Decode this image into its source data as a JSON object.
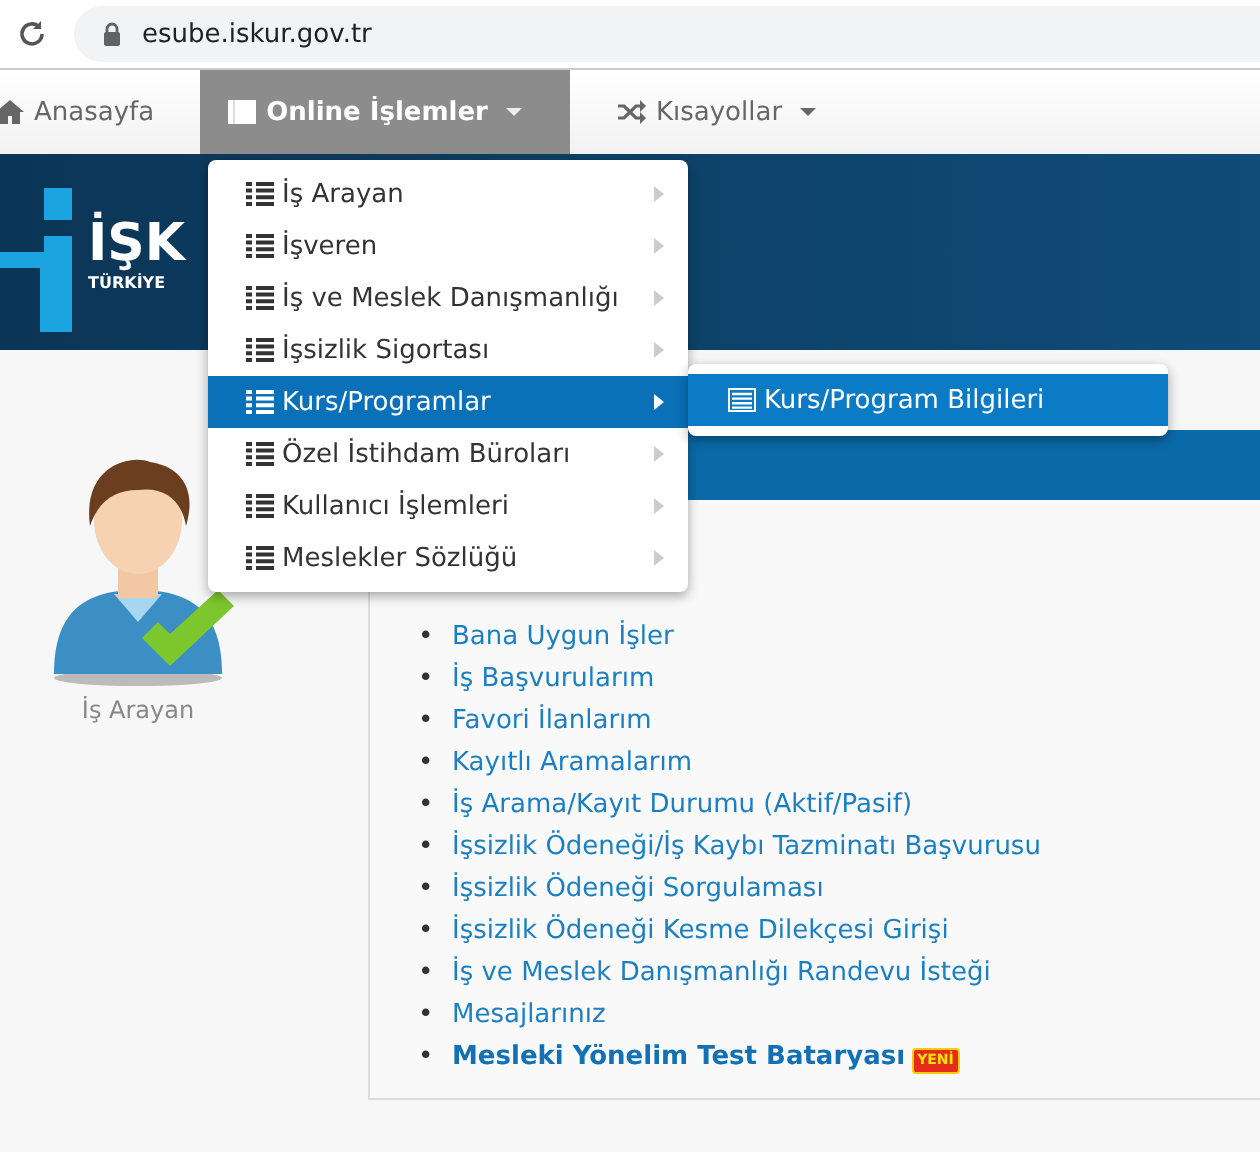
{
  "browser": {
    "address": "esube.iskur.gov.tr"
  },
  "nav": [
    {
      "label": "Anasayfa",
      "kind": "home",
      "selected": false
    },
    {
      "label": "Online İşlemler",
      "kind": "services",
      "selected": true
    },
    {
      "label": "Kısayollar",
      "kind": "shortcuts",
      "selected": false
    }
  ],
  "banner": {
    "logo": "İŞK",
    "subtitle": "TÜRKİYE"
  },
  "menu": [
    {
      "label": "İş Arayan",
      "selected": false
    },
    {
      "label": "İşveren",
      "selected": false
    },
    {
      "label": "İş ve Meslek Danışmanlığı",
      "selected": false
    },
    {
      "label": "İşsizlik Sigortası",
      "selected": false
    },
    {
      "label": "Kurs/Programlar",
      "selected": true
    },
    {
      "label": "Özel İstihdam Büroları",
      "selected": false
    },
    {
      "label": "Kullanıcı İşlemleri",
      "selected": false
    },
    {
      "label": "Meslekler Sözlüğü",
      "selected": false
    }
  ],
  "submenu": [
    {
      "label": "Kurs/Program Bilgileri",
      "selected": true
    }
  ],
  "profile": {
    "label": "İş Arayan"
  },
  "links": [
    {
      "bullet": "•",
      "label": "Bana Uygun İşler",
      "kind": "plain"
    },
    {
      "bullet": "•",
      "label": "İş Başvurularım",
      "kind": "plain"
    },
    {
      "bullet": "•",
      "label": "Favori İlanlarım",
      "kind": "plain"
    },
    {
      "bullet": "•",
      "label": "Kayıtlı Aramalarım",
      "kind": "plain"
    },
    {
      "bullet": "•",
      "label": "İş Arama/Kayıt Durumu (Aktif/Pasif)",
      "kind": "plain"
    },
    {
      "bullet": "•",
      "label": "İşsizlik Ödeneği/İş Kaybı Tazminatı Başvurusu",
      "kind": "plain"
    },
    {
      "bullet": "•",
      "label": "İşsizlik Ödeneği Sorgulaması",
      "kind": "plain"
    },
    {
      "bullet": "•",
      "label": "İşsizlik Ödeneği Kesme Dilekçesi Girişi",
      "kind": "plain"
    },
    {
      "bullet": "•",
      "label": "İş ve Meslek Danışmanlığı Randevu İsteği",
      "kind": "plain"
    },
    {
      "bullet": "•",
      "label": "Mesajlarınız",
      "kind": "plain"
    },
    {
      "bullet": "•",
      "label": "Mesleki Yönelim Test Bataryası",
      "kind": "featured",
      "badge": "YENİ"
    }
  ]
}
